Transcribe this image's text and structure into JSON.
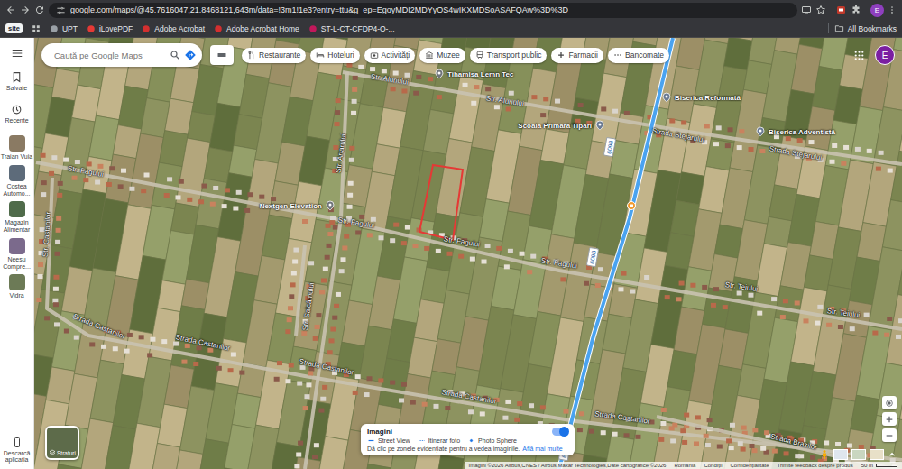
{
  "browser": {
    "url": "google.com/maps/@45.7616047,21.8468121,643m/data=!3m1!1e3?entry=ttu&g_ep=EgoyMDI2MDYyOS4wIKXMDSoASAFQAw%3D%3D",
    "profile": "E",
    "site_badge": "site",
    "bookmarks": [
      "UPT",
      "iLovePDF",
      "Adobe Acrobat",
      "Adobe Acrobat Home",
      "ST-L-CT-CFDP4-O-..."
    ],
    "all_bookmarks": "All Bookmarks"
  },
  "sidebar": {
    "items": [
      {
        "label": "Salvate"
      },
      {
        "label": "Recente"
      }
    ],
    "recent": [
      "Traian Vuia",
      "Costea Automo...",
      "Magazin Alimentar",
      "Neesu Compre...",
      "Vidra"
    ],
    "download": "Descarcă aplicația"
  },
  "search": {
    "placeholder": "Caută pe Google Maps"
  },
  "chips": [
    "Restaurante",
    "Hoteluri",
    "Activități",
    "Muzee",
    "Transport public",
    "Farmacii",
    "Bancomate"
  ],
  "account": {
    "letter": "E"
  },
  "map": {
    "streets": [
      "Str. Alunului",
      "Str. Alunului",
      "Str. Fagului",
      "Str. Fagului",
      "Str. Fagului",
      "Str. Fagului",
      "Str. Artarului",
      "Str. Castanilor",
      "Str. Salcâmului",
      "Strada Castanilor",
      "Strada Castanilor",
      "Strada Castanilor",
      "Strada Castanilor",
      "Strada Castanilor",
      "Strada Stejarului",
      "Strada Stejarului",
      "Str. Teiului",
      "Str. Teiului",
      "Strada Brazilor"
    ],
    "places": [
      {
        "label": "Tihamisa Lemn Tec",
        "kind": "business"
      },
      {
        "label": "Scoala Primară Tipari",
        "kind": "school"
      },
      {
        "label": "Biserica Reformată",
        "kind": "church"
      },
      {
        "label": "Biserica Adventistă",
        "kind": "church"
      },
      {
        "label": "Nextgen Elevation",
        "kind": "business"
      }
    ],
    "road_shields": [
      "609B",
      "609B",
      "609B"
    ]
  },
  "layers": {
    "label": "Straturi"
  },
  "imagery": {
    "title": "Imagini",
    "enabled": true,
    "legend": [
      {
        "label": "Street View",
        "kind": "line"
      },
      {
        "label": "Itinerar foto",
        "kind": "dots"
      },
      {
        "label": "Photo Sphere",
        "kind": "sphere"
      }
    ],
    "hint": "Dă clic pe zonele evidențiate pentru a vedea imaginile.",
    "link": "Află mai multe"
  },
  "footer": {
    "attribution": "Imagini ©2026 Airbus,CNES / Airbus,Maxar Technologies,Date cartografice ©2026",
    "links": [
      "România",
      "Condiții",
      "Confidențialitate",
      "Trimite feedback despre produs"
    ],
    "scale": "50 m"
  }
}
